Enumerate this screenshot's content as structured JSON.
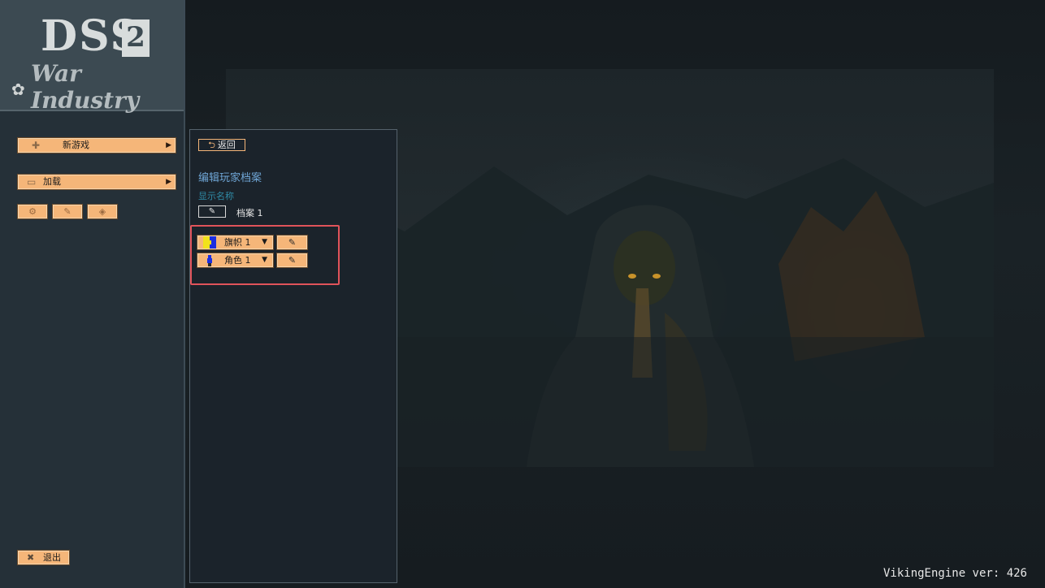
{
  "logo": {
    "title": "DSS",
    "edition": "2",
    "subtitle": "War Industry"
  },
  "sidebar": {
    "new_game": "新游戏",
    "load": "加载",
    "exit": "退出"
  },
  "panel": {
    "back": "返回",
    "title": "编辑玩家档案",
    "display_name_label": "显示名称",
    "display_name_value": "档案 1",
    "banner_select": "旗帜 1",
    "character_select": "角色 1"
  },
  "version": "VikingEngine ver: 426",
  "colors": {
    "button": "#f5b679",
    "panel_bg": "#1b232b",
    "title_blue": "#6fa6d6",
    "highlight": "#e0535a"
  },
  "icons": {
    "new_game": "plus-icon",
    "load": "folder-icon",
    "back": "return-arrow-icon",
    "edit": "pencil-icon",
    "exit": "close-icon"
  }
}
